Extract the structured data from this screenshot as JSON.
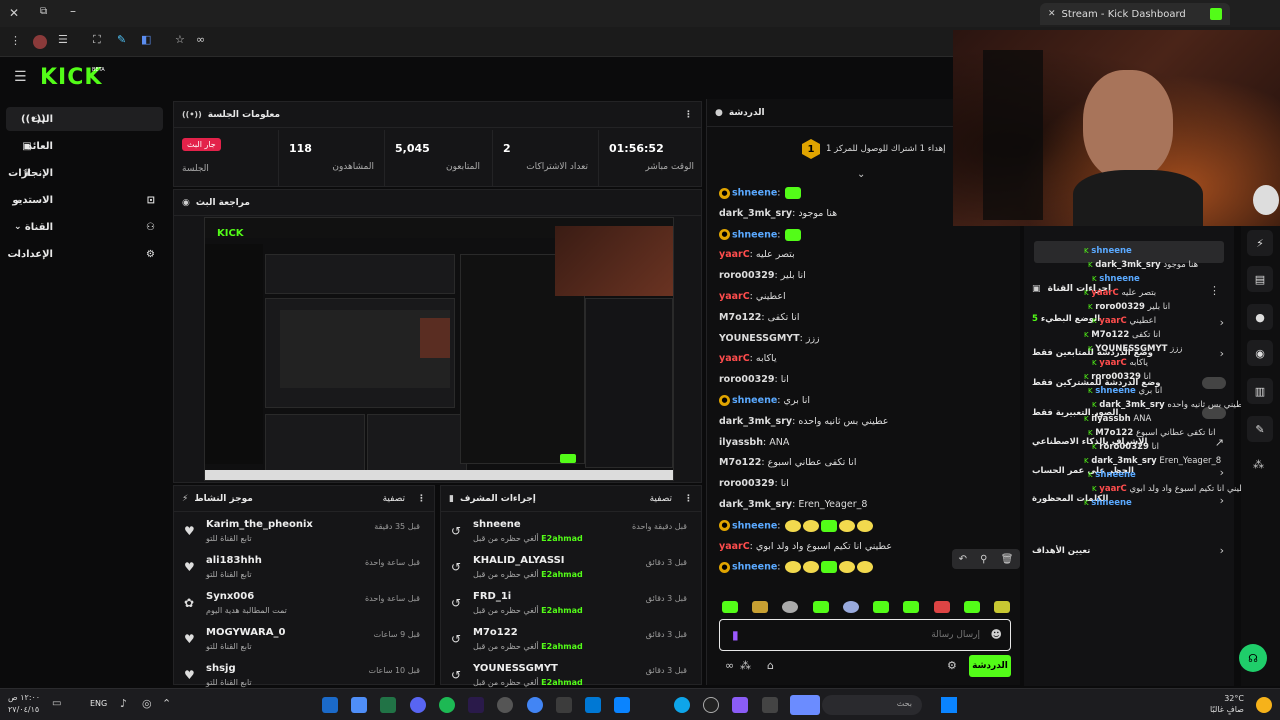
{
  "browser": {
    "tab_title": "Stream - Kick Dashboard",
    "new_tab": "+"
  },
  "app": {
    "logo": "KICK",
    "beta": "BETA"
  },
  "sidebar": {
    "items": [
      {
        "label": "البث",
        "icon": "broadcast-icon"
      },
      {
        "label": "العائد",
        "icon": "wallet-icon"
      },
      {
        "label": "الإنجازات",
        "icon": "trophy-icon"
      },
      {
        "label": "الاستديو",
        "icon": "studio-icon"
      },
      {
        "label": "القناة",
        "icon": "channel-icon"
      },
      {
        "label": "الإعدادات",
        "icon": "gear-icon"
      }
    ]
  },
  "session": {
    "title": "معلومات الجلسة",
    "live_badge": "جار البث",
    "live_label": "الجلسة",
    "stats": [
      {
        "value": "118",
        "label": "المشاهدون"
      },
      {
        "value": "5,045",
        "label": "المتابعون"
      },
      {
        "value": "2",
        "label": "تعداد الاشتراكات"
      },
      {
        "value": "01:56:52",
        "label": "الوقت مباشر"
      }
    ]
  },
  "preview": {
    "title": "مراجعة البث"
  },
  "activity": {
    "title": "موجز النشاط",
    "filter": "تصفية",
    "rows": [
      {
        "name": "Karim_the_pheonix",
        "sub": "تابع القناة للتو",
        "time": "قبل 35 دقيقة",
        "icon": "heart-icon"
      },
      {
        "name": "ali183hhh",
        "sub": "تابع القناة للتو",
        "time": "قبل ساعة واحدة",
        "icon": "heart-icon"
      },
      {
        "name": "Synx006",
        "sub": "تمت المطالبة هدية اليوم",
        "time": "قبل ساعة واحدة",
        "icon": "gift-icon"
      },
      {
        "name": "MOGYWARA_0",
        "sub": "تابع القناة للتو",
        "time": "قبل 9 ساعات",
        "icon": "heart-icon"
      },
      {
        "name": "shsjg",
        "sub": "تابع القناة للتو",
        "time": "قبل 10 ساعات",
        "icon": "heart-icon"
      }
    ]
  },
  "modactions": {
    "title": "إجراءات المشرف",
    "filter": "تصفية",
    "rows": [
      {
        "name": "shneene",
        "sub": "ألغي حظره من قبل",
        "by": "E2ahmad",
        "time": "قبل دقيقة واحدة"
      },
      {
        "name": "KHALID_ALYASSI",
        "sub": "ألغي حظره من قبل",
        "by": "E2ahmad",
        "time": "قبل 3 دقائق"
      },
      {
        "name": "FRD_1i",
        "sub": "ألغي حظره من قبل",
        "by": "E2ahmad",
        "time": "قبل 3 دقائق"
      },
      {
        "name": "M7o122",
        "sub": "ألغي حظره من قبل",
        "by": "E2ahmad",
        "time": "قبل 3 دقائق"
      },
      {
        "name": "YOUNESSGMYT",
        "sub": "ألغي حظره من قبل",
        "by": "E2ahmad",
        "time": "قبل 3 دقائق"
      }
    ]
  },
  "chat": {
    "title": "الدردشة",
    "pinned": "إهداء 1 اشتراك للوصول للمركز 1",
    "pinned_rank": "1",
    "messages": [
      {
        "user": "shneene",
        "color": "#5aa9ff",
        "text": "",
        "emotes": 1,
        "badge": true
      },
      {
        "user": "dark_3mk_sry",
        "color": "#dddddd",
        "text": "هنا موجود"
      },
      {
        "user": "shneene",
        "color": "#5aa9ff",
        "text": "",
        "emotes": 1,
        "badge": true
      },
      {
        "user": "yaarC",
        "color": "#ff4d4d",
        "text": "بتصر عليه"
      },
      {
        "user": "roro00329",
        "color": "#dddddd",
        "text": "انا بلير"
      },
      {
        "user": "yaarC",
        "color": "#ff4d4d",
        "text": "اعطيني"
      },
      {
        "user": "M7o122",
        "color": "#dddddd",
        "text": "انا تكفى"
      },
      {
        "user": "YOUNESSGMYT",
        "color": "#dddddd",
        "text": "ززز"
      },
      {
        "user": "yaarC",
        "color": "#ff4d4d",
        "text": "ياكابه"
      },
      {
        "user": "roro00329",
        "color": "#dddddd",
        "text": "انا"
      },
      {
        "user": "shneene",
        "color": "#5aa9ff",
        "text": "انا بري",
        "badge": true
      },
      {
        "user": "dark_3mk_sry",
        "color": "#dddddd",
        "text": "عطيني بس ثانيه واحده"
      },
      {
        "user": "ilyassbh",
        "color": "#dddddd",
        "text": "ANA"
      },
      {
        "user": "M7o122",
        "color": "#dddddd",
        "text": "انا تكفى عطاني اسبوع"
      },
      {
        "user": "roro00329",
        "color": "#dddddd",
        "text": "انا"
      },
      {
        "user": "dark_3mk_sry",
        "color": "#dddddd",
        "text": "Eren_Yeager_8"
      },
      {
        "user": "shneene",
        "color": "#5aa9ff",
        "text": "",
        "emotes": 5,
        "badge": true
      },
      {
        "user": "yaarC",
        "color": "#ff4d4d",
        "text": "عطيني انا تكيم اسبوع واد ولد ابوي"
      },
      {
        "user": "shneene",
        "color": "#5aa9ff",
        "text": "",
        "emotes": 5,
        "badge": true
      }
    ],
    "input_placeholder": "إرسال رسالة",
    "send_label": "الدردشة"
  },
  "overlay": {
    "header": "إجراءات القناة",
    "items": [
      "الوضع البطيء",
      "وضع الدردشة للمتابعين فقط",
      "وضع الدردشة للمشتركين فقط",
      "الصور التعبيرية فقط",
      "الإشراف بالذكاء الاصطناعي",
      "الحظر على عمر الحساب",
      "الكلمات المحظورة",
      "تعيين الأهداف"
    ],
    "slow_value": "5"
  },
  "taskbar": {
    "time": "١٢:٠٠ ص",
    "date": "٢٧/٠٤/١٥",
    "lang": "ENG",
    "weather_temp": "32°C",
    "weather_desc": "صافٍ غالبًا",
    "search": "بحث"
  },
  "colors": {
    "brand": "#53fc18",
    "live": "#e3224a",
    "panel": "#151517",
    "bg": "#0b0b0c"
  }
}
